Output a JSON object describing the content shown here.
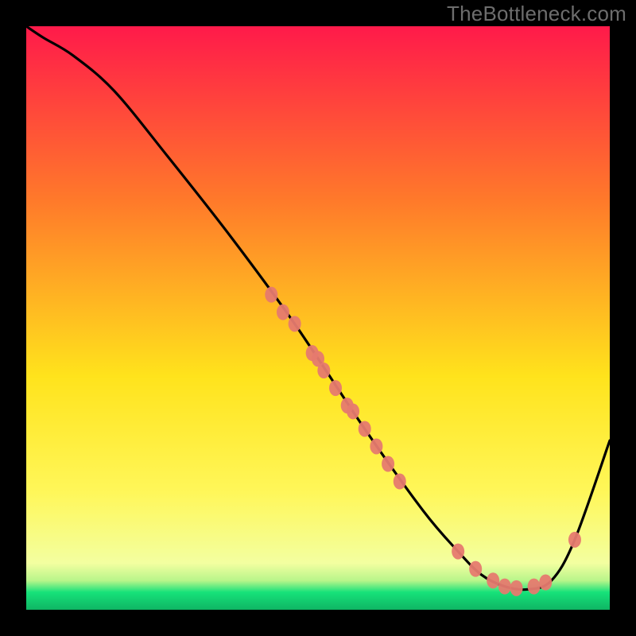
{
  "watermark": "TheBottleneck.com",
  "chart_data": {
    "type": "line",
    "title": "",
    "xlabel": "",
    "ylabel": "",
    "xlim": [
      0,
      100
    ],
    "ylim": [
      0,
      100
    ],
    "grid": false,
    "legend": false,
    "background_gradient": {
      "top_color": "#ff1a4a",
      "mid_upper_color": "#ff7a2a",
      "mid_color": "#ffe31c",
      "mid_lower_color": "#fff75a",
      "bottom_band_color": "#16e27a",
      "bottom_edge_color": "#0fb564"
    },
    "curve": {
      "x": [
        0,
        3,
        8,
        15,
        24,
        35,
        46,
        58,
        68,
        74,
        78,
        82,
        86,
        90,
        94,
        100
      ],
      "y": [
        100,
        98,
        95,
        89,
        78,
        64,
        49,
        31,
        17,
        10,
        6,
        4,
        3.5,
        5,
        12,
        29
      ],
      "stroke": "#000000"
    },
    "marker_groups": [
      {
        "name": "upper-cluster",
        "color": "#e67a6f",
        "points_x": [
          42,
          44,
          46,
          49,
          50,
          51,
          53,
          55,
          56,
          58,
          60,
          62,
          64
        ],
        "points_y": [
          54,
          51,
          49,
          44,
          43,
          41,
          38,
          35,
          34,
          31,
          28,
          25,
          22
        ]
      },
      {
        "name": "trough-cluster",
        "color": "#e67a6f",
        "points_x": [
          74,
          77,
          80,
          82,
          84,
          87,
          89
        ],
        "points_y": [
          10,
          7,
          5,
          4,
          3.7,
          4,
          4.7
        ]
      },
      {
        "name": "right-point",
        "color": "#e67a6f",
        "points_x": [
          94
        ],
        "points_y": [
          12
        ]
      }
    ]
  }
}
